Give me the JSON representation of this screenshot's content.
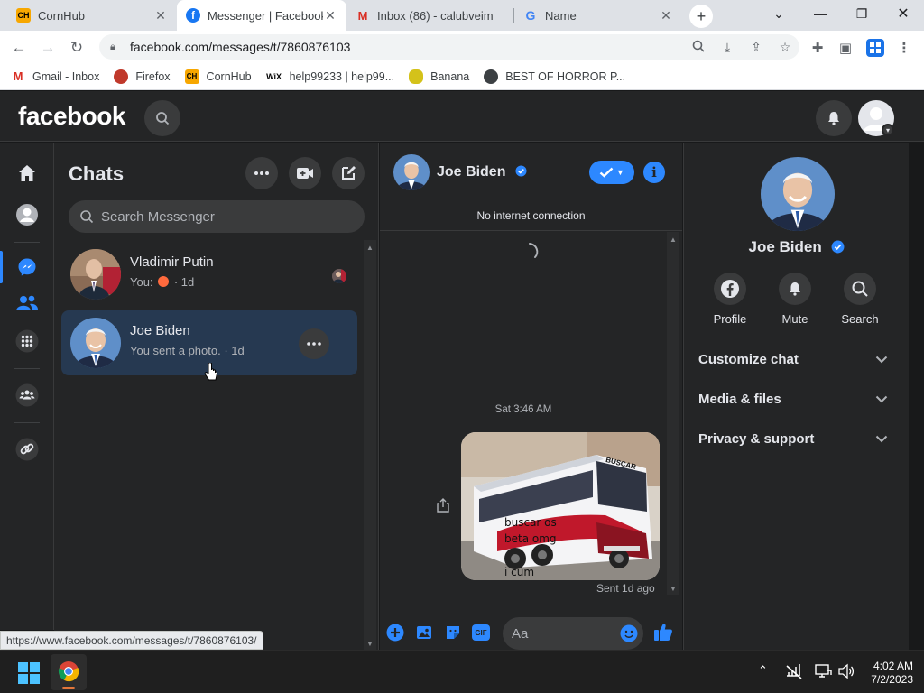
{
  "browser": {
    "tabs": [
      {
        "title": "CornHub",
        "favicon": "CH"
      },
      {
        "title": "Messenger | Facebook",
        "favicon": "f"
      },
      {
        "title": "Inbox (86) - calubveim",
        "favicon": "M"
      },
      {
        "title": "Name",
        "favicon": "G"
      }
    ],
    "url": "facebook.com/messages/t/7860876103",
    "bookmarks": [
      {
        "label": "Gmail - Inbox",
        "icon": "M"
      },
      {
        "label": "Firefox",
        "icon": "ff"
      },
      {
        "label": "CornHub",
        "icon": "CH"
      },
      {
        "label": "help99233 | help99...",
        "icon": "WiX"
      },
      {
        "label": "Banana",
        "icon": "b"
      },
      {
        "label": "BEST OF HORROR P...",
        "icon": "o"
      }
    ],
    "status_url": "https://www.facebook.com/messages/t/7860876103/"
  },
  "fb": {
    "logo": "facebook"
  },
  "chats": {
    "title": "Chats",
    "search_placeholder": "Search Messenger",
    "items": [
      {
        "name": "Vladimir Putin",
        "preview_prefix": "You:",
        "preview_suffix": "· 1d"
      },
      {
        "name": "Joe Biden",
        "preview": "You sent a photo. · 1d"
      }
    ]
  },
  "conversation": {
    "name": "Joe Biden",
    "notice": "No internet connection",
    "timestamp": "Sat 3:46 AM",
    "photo_caption_lines": [
      "buscar os",
      "beta omg",
      "i cum"
    ],
    "photo_brand": "BUSCAR",
    "status": "Sent 1d ago",
    "input_placeholder": "Aa",
    "gif_label": "GIF"
  },
  "info_panel": {
    "name": "Joe Biden",
    "actions": [
      {
        "label": "Profile",
        "icon": "facebook-icon"
      },
      {
        "label": "Mute",
        "icon": "bell-icon"
      },
      {
        "label": "Search",
        "icon": "search-icon"
      }
    ],
    "sections": [
      "Customize chat",
      "Media & files",
      "Privacy & support"
    ]
  },
  "taskbar": {
    "time": "4:02 AM",
    "date": "7/2/2023"
  },
  "colors": {
    "accent": "#2d88ff",
    "bg": "#242526",
    "selected_chat": "#263951"
  }
}
